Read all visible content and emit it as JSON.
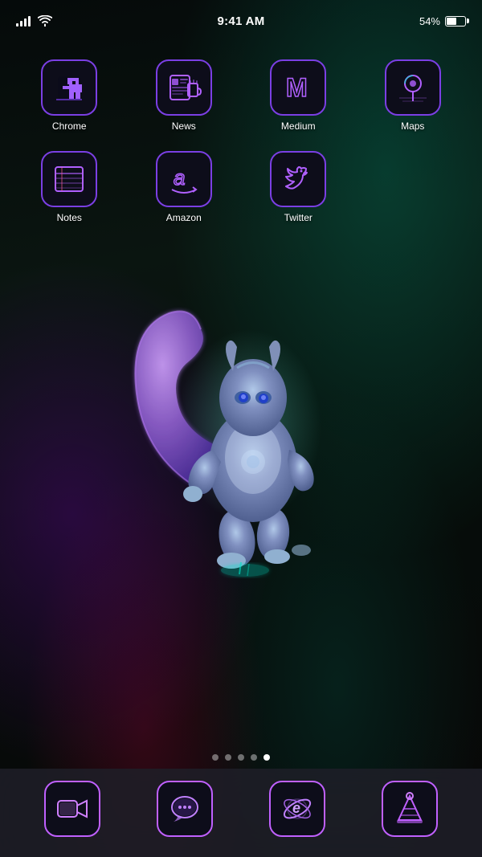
{
  "statusBar": {
    "time": "9:41 AM",
    "battery": "54%",
    "batteryFill": 54
  },
  "apps": [
    {
      "id": "chrome",
      "label": "Chrome",
      "row": 1
    },
    {
      "id": "news",
      "label": "News",
      "row": 1
    },
    {
      "id": "medium",
      "label": "Medium",
      "row": 1
    },
    {
      "id": "maps",
      "label": "Maps",
      "row": 1
    },
    {
      "id": "notes",
      "label": "Notes",
      "row": 2
    },
    {
      "id": "amazon",
      "label": "Amazon",
      "row": 2
    },
    {
      "id": "twitter",
      "label": "Twitter",
      "row": 2
    }
  ],
  "dock": [
    {
      "id": "facetime",
      "label": "FaceTime"
    },
    {
      "id": "messages",
      "label": "Messages"
    },
    {
      "id": "ie",
      "label": "Internet Explorer"
    },
    {
      "id": "vlc",
      "label": "VLC"
    }
  ],
  "pageDots": [
    {
      "active": false
    },
    {
      "active": false
    },
    {
      "active": false
    },
    {
      "active": false
    },
    {
      "active": true
    }
  ],
  "colors": {
    "accent": "#b060ff",
    "accentAlt": "#7b3fe4",
    "cyan": "#00e5c8",
    "iconBg": "#0d0d1a"
  }
}
